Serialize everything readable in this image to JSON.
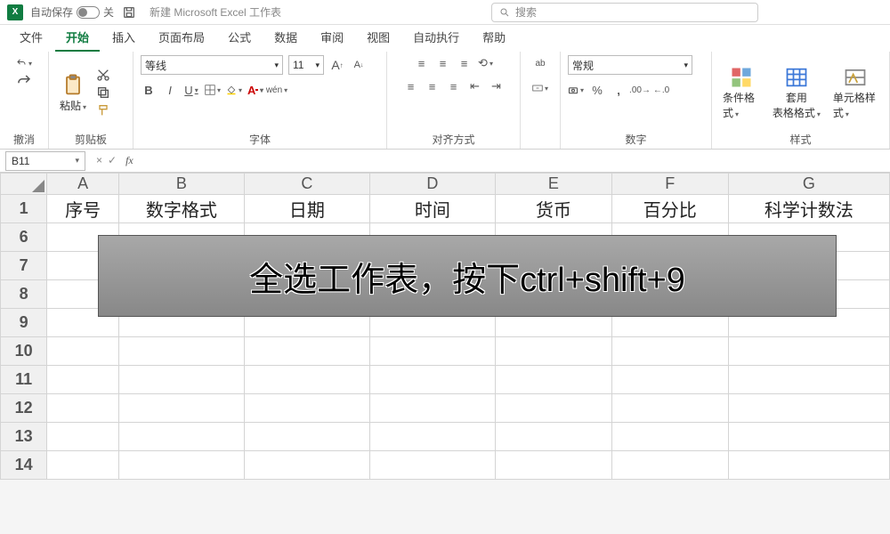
{
  "titlebar": {
    "app_abbr": "X",
    "autosave_label": "自动保存",
    "autosave_state": "关",
    "doc_title": "新建 Microsoft Excel 工作表",
    "search_placeholder": "搜索"
  },
  "menu": {
    "tabs": [
      "文件",
      "开始",
      "插入",
      "页面布局",
      "公式",
      "数据",
      "审阅",
      "视图",
      "自动执行",
      "帮助"
    ],
    "active_index": 1
  },
  "ribbon": {
    "undo_group": "撤消",
    "clipboard": {
      "paste": "粘贴",
      "group": "剪贴板"
    },
    "font": {
      "name": "等线",
      "size": "11",
      "group": "字体",
      "bold": "B",
      "italic": "I",
      "underline": "U",
      "wen": "wén"
    },
    "align": {
      "group": "对齐方式",
      "wrap": "ab"
    },
    "number": {
      "format": "常规",
      "group": "数字",
      "percent": "%",
      "comma": ","
    },
    "styles": {
      "cond": "条件格式",
      "table": "套用\n表格格式",
      "cell": "单元格样式",
      "group": "样式"
    }
  },
  "formula_bar": {
    "namebox": "B11",
    "cancel": "×",
    "confirm": "✓",
    "fx": "fx",
    "value": ""
  },
  "grid": {
    "columns": [
      "A",
      "B",
      "C",
      "D",
      "E",
      "F",
      "G"
    ],
    "rows": [
      "1",
      "6",
      "7",
      "8",
      "9",
      "10",
      "11",
      "12",
      "13",
      "14"
    ],
    "header_row": [
      "序号",
      "数字格式",
      "日期",
      "时间",
      "货币",
      "百分比",
      "科学计数法"
    ]
  },
  "overlay": {
    "text": "全选工作表，按下ctrl+shift+9"
  }
}
